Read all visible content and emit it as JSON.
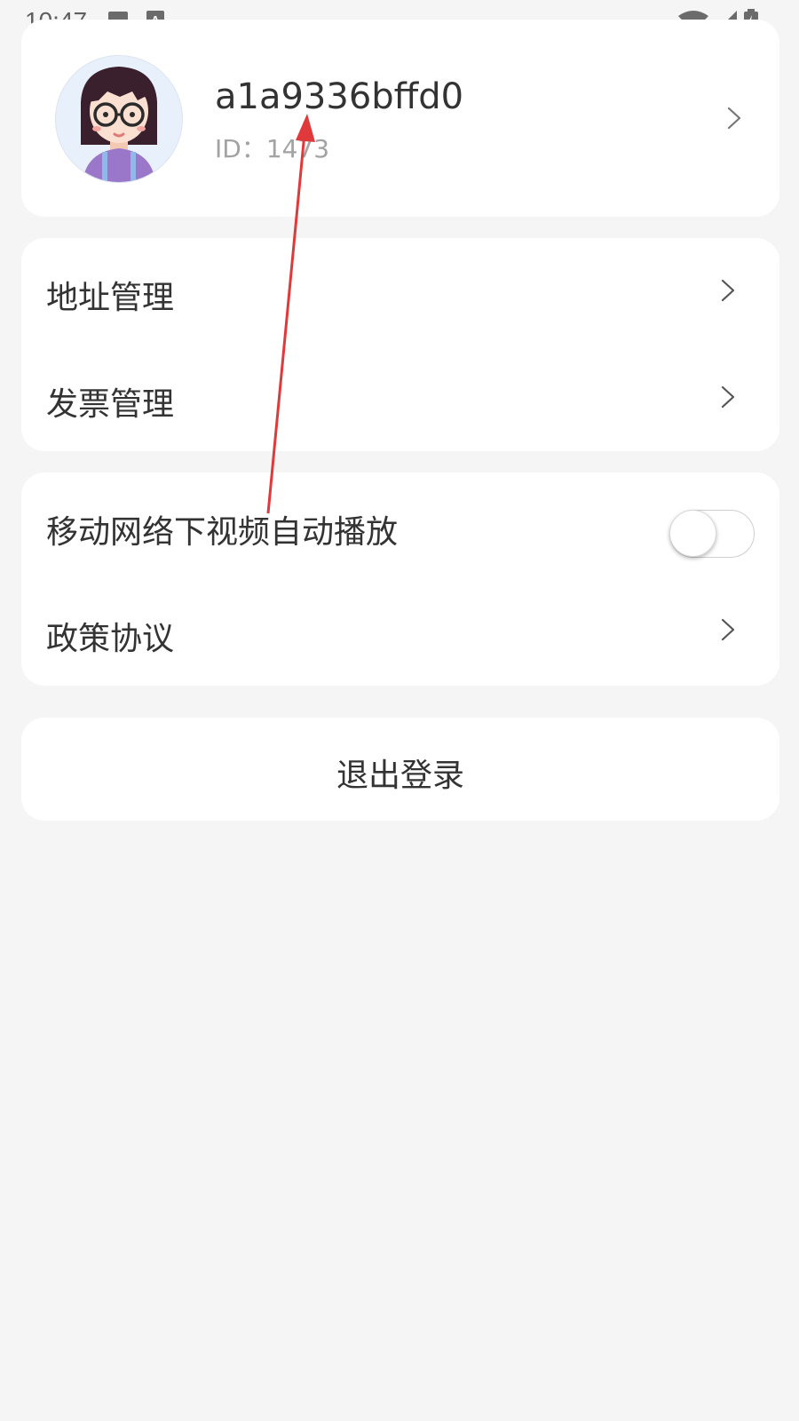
{
  "status_bar": {
    "time": "10:47",
    "left_icons": [
      "image-icon",
      "text-a-icon"
    ],
    "right_icons": [
      "wifi-icon",
      "signal-icon",
      "battery-icon"
    ]
  },
  "profile": {
    "username": "a1a9336bffd0",
    "id_text": "ID：1473",
    "avatar_icon": "avatar-girl-glasses"
  },
  "menu_group_1": {
    "items": [
      {
        "label": "地址管理"
      },
      {
        "label": "发票管理"
      }
    ]
  },
  "menu_group_2": {
    "autoplay_label": "移动网络下视频自动播放",
    "autoplay_enabled": false,
    "policy_label": "政策协议"
  },
  "logout": {
    "label": "退出登录"
  },
  "colors": {
    "background": "#f5f5f5",
    "card": "#ffffff",
    "annotation_arrow": "#e0393b"
  }
}
